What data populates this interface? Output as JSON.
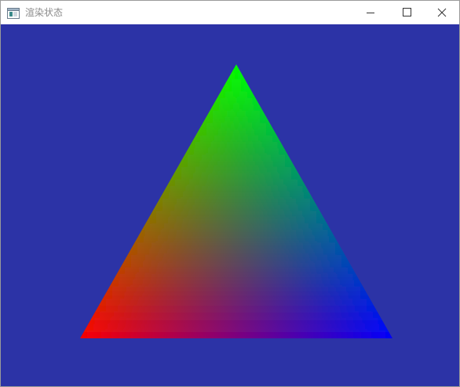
{
  "window": {
    "title": "渲染状态",
    "icon": "app-window-icon",
    "controls": {
      "minimize_icon": "minimize-icon",
      "maximize_icon": "maximize-icon",
      "close_icon": "close-icon"
    }
  },
  "viewport": {
    "clear_color": "#2c33a6",
    "triangle": {
      "vertex_colors": {
        "top": "#00ff00",
        "bottom_left": "#ff0000",
        "bottom_right": "#0000ff"
      }
    }
  }
}
